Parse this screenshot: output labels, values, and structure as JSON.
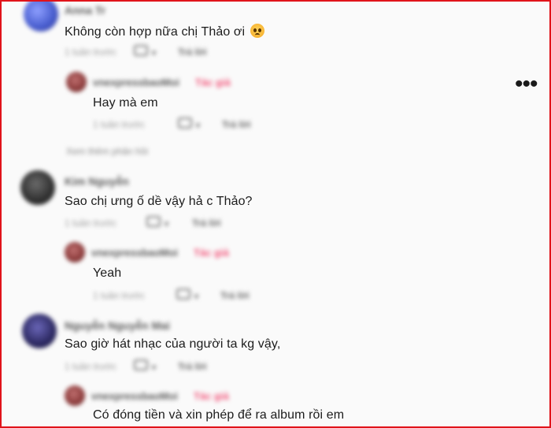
{
  "comments": [
    {
      "author": "Anna Tr",
      "text": "Không còn hợp nữa chị Thảo ơi",
      "emoji": "pleading-face-icon",
      "time": "1 tuần trước",
      "like_count": "",
      "reply_label": "Trả lời",
      "replies": [
        {
          "author": "vnexpressbaoMoi",
          "badge": "Tác giả",
          "text": "Hay mà em",
          "time": "1 tuần trước",
          "reply_label": "Trả lời"
        }
      ],
      "view_replies_label": "Xem thêm phản hồi"
    },
    {
      "author": "Kim Nguyễn",
      "text": "Sao chị ưng ố dề vậy hả c Thảo?",
      "time": "1 tuần trước",
      "reply_label": "Trả lời",
      "replies": [
        {
          "author": "vnexpressbaoMoi",
          "badge": "Tác giả",
          "text": "Yeah",
          "time": "1 tuần trước",
          "reply_label": "Trả lời"
        }
      ]
    },
    {
      "author": "Nguyễn Nguyễn Mai",
      "text": "Sao giờ hát nhạc của người ta kg vậy,",
      "time": "1 tuần trước",
      "reply_label": "Trả lời",
      "replies": [
        {
          "author": "vnexpressbaoMoi",
          "badge": "Tác giả",
          "text": "Có đóng tiền và xin phép để ra album rồi em"
        }
      ]
    }
  ],
  "colors": {
    "border": "#e0131a",
    "author_badge": "#f2557a",
    "avatar1": "#4a5fd0",
    "avatar2": "#2f2f2f",
    "avatar3": "#2b2860",
    "reply_avatar": "#8a3a3a"
  },
  "icons": {
    "more": "more-options-icon",
    "like": "thumbs-up-icon",
    "dropdown": "chevron-down-icon"
  }
}
